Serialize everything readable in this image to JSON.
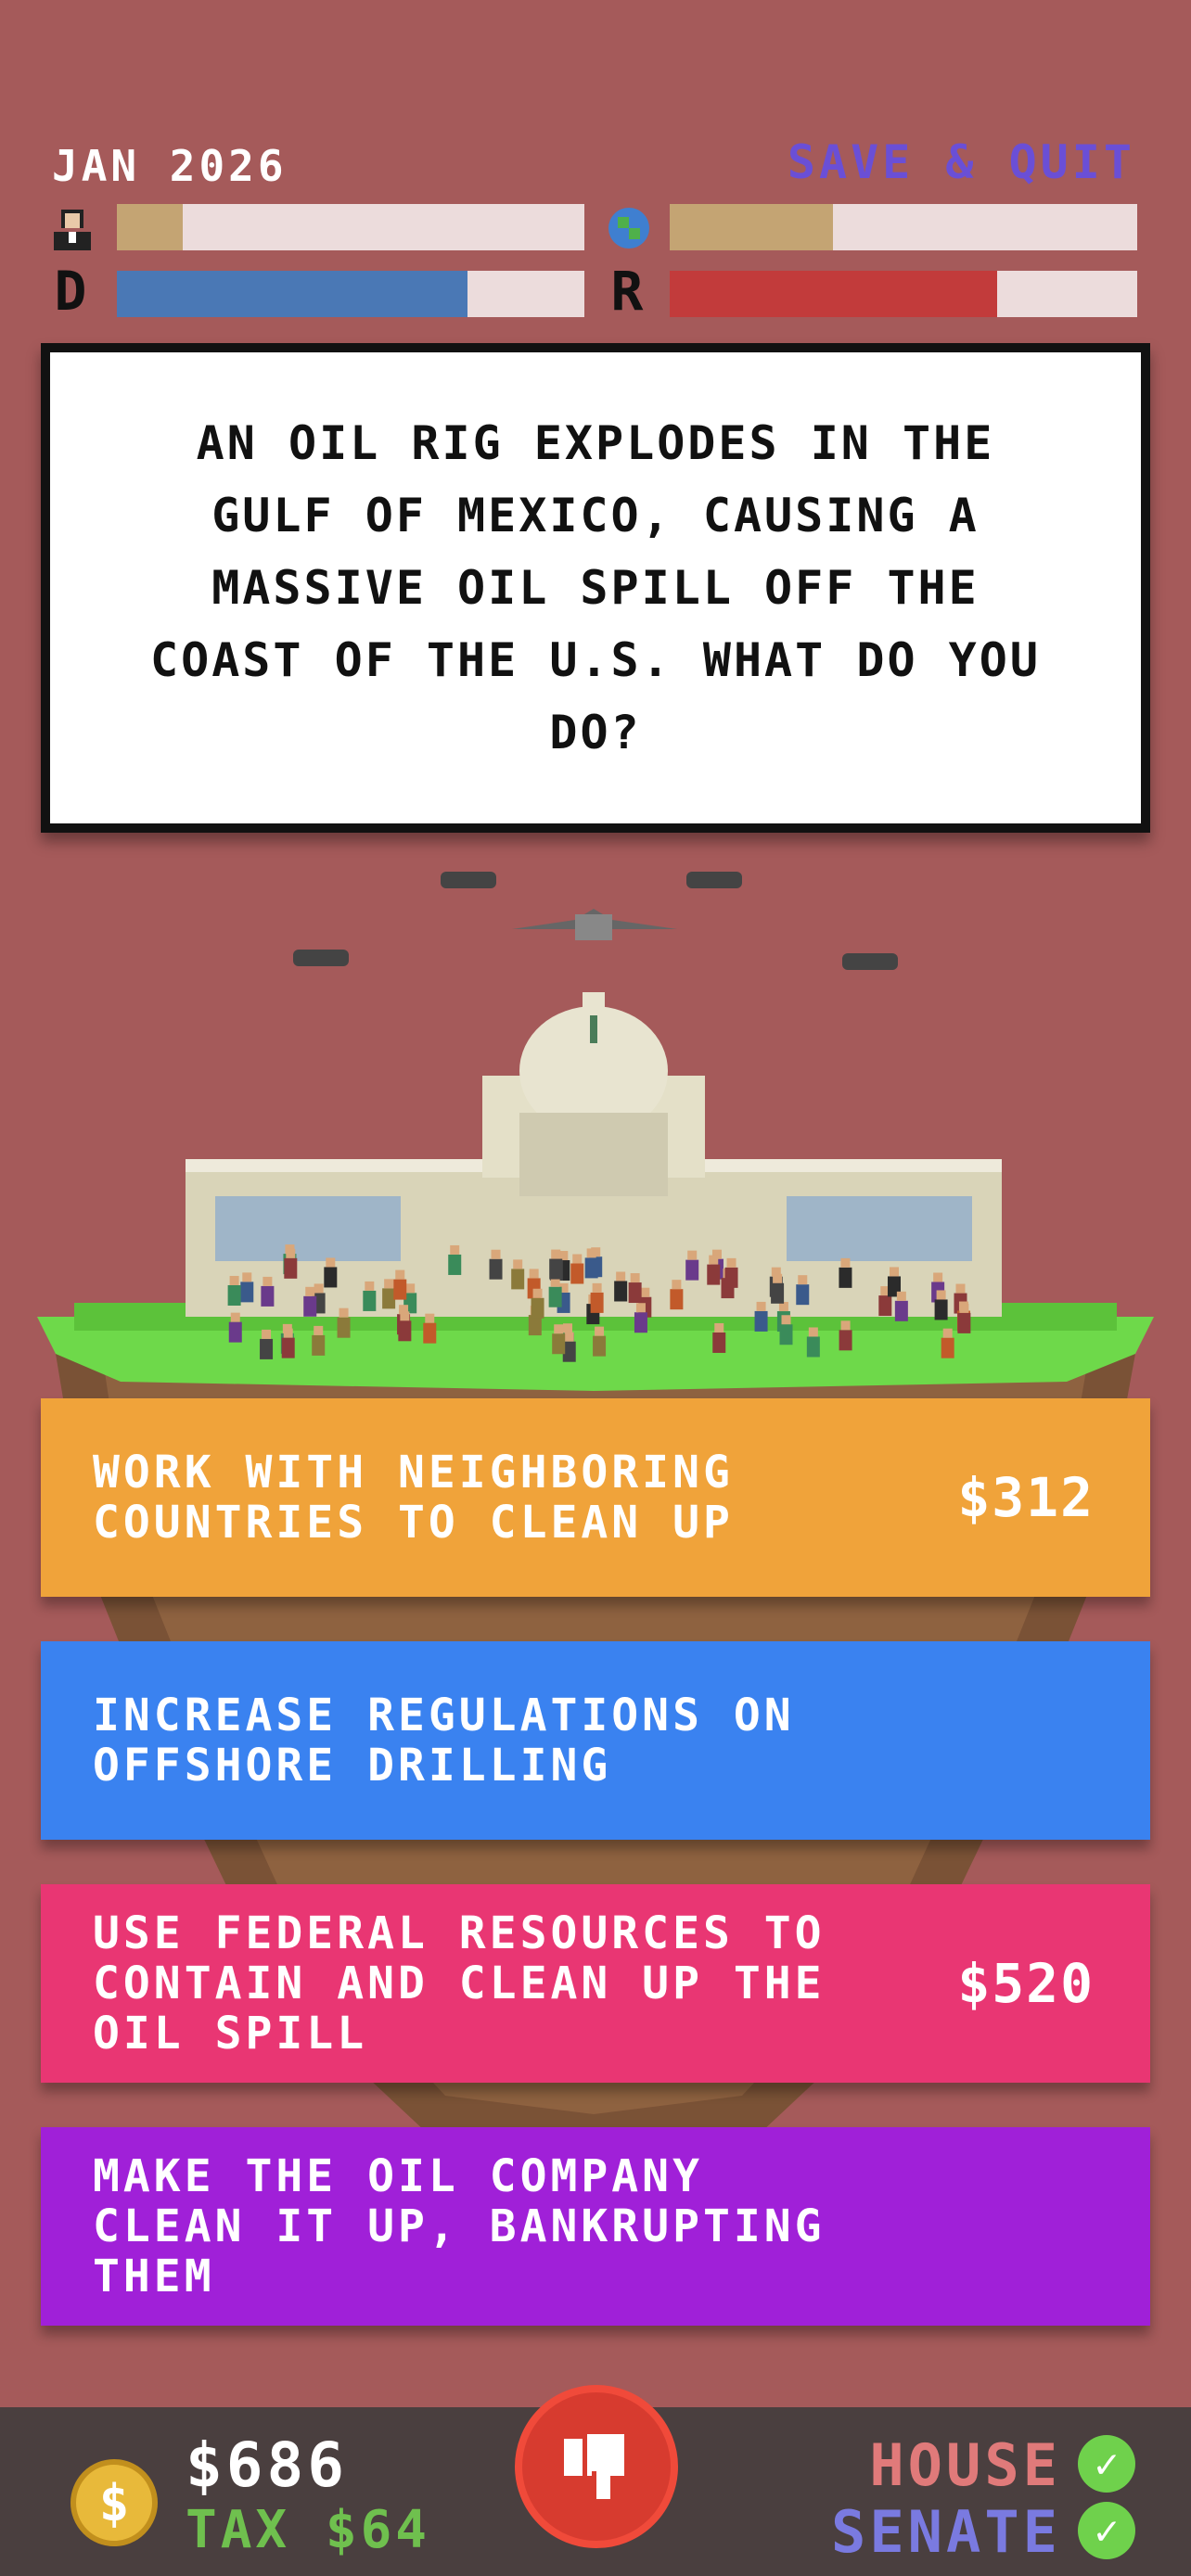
{
  "header": {
    "date": "JAN 2026",
    "save_quit": "SAVE & QUIT"
  },
  "meters": {
    "approval": {
      "icon": "person-icon",
      "fill": 0.14,
      "color": "#c4a473"
    },
    "world": {
      "icon": "globe-icon",
      "fill": 0.35,
      "color": "#c4a473"
    },
    "democrats": {
      "label": "D",
      "fill": 0.75,
      "color": "#4a78b5"
    },
    "republicans": {
      "label": "R",
      "fill": 0.7,
      "color": "#c23b3b"
    }
  },
  "question": {
    "text": "AN OIL RIG EXPLODES IN THE GULF OF MEXICO, CAUSING A MASSIVE OIL SPILL OFF THE COAST OF THE U.S. WHAT DO YOU DO?"
  },
  "choices": [
    {
      "label": "WORK WITH NEIGHBORING COUNTRIES TO CLEAN UP",
      "cost": "$312",
      "color": "#f0a33a"
    },
    {
      "label": "INCREASE REGULATIONS ON OFFSHORE DRILLING",
      "cost": "",
      "color": "#3a82f0"
    },
    {
      "label": "USE FEDERAL RESOURCES TO CONTAIN AND CLEAN UP THE OIL SPILL",
      "cost": "$520",
      "color": "#e93673"
    },
    {
      "label": "MAKE THE OIL COMPANY CLEAN IT UP, BANKRUPTING THEM",
      "cost": "",
      "color": "#a020d8"
    }
  ],
  "footer": {
    "money": "$686",
    "tax": "TAX $64",
    "house": "HOUSE",
    "senate": "SENATE"
  }
}
